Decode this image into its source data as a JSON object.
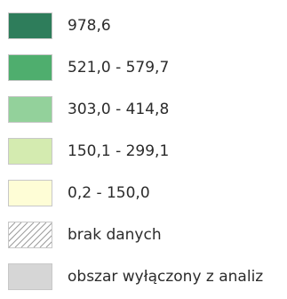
{
  "legend": {
    "items": [
      {
        "label": "978,6",
        "color": "#2e7d5b",
        "pattern": "solid"
      },
      {
        "label": "521,0 - 579,7",
        "color": "#4fae6e",
        "pattern": "solid"
      },
      {
        "label": "303,0 - 414,8",
        "color": "#93d19b",
        "pattern": "solid"
      },
      {
        "label": "150,1 - 299,1",
        "color": "#d4ebb0",
        "pattern": "solid"
      },
      {
        "label": "0,2 - 150,0",
        "color": "#fefdd6",
        "pattern": "solid"
      },
      {
        "label": "brak danych",
        "color": "#ffffff",
        "pattern": "hatch"
      },
      {
        "label": "obszar wyłączony z analiz",
        "color": "#d6d6d6",
        "pattern": "solid"
      }
    ]
  }
}
